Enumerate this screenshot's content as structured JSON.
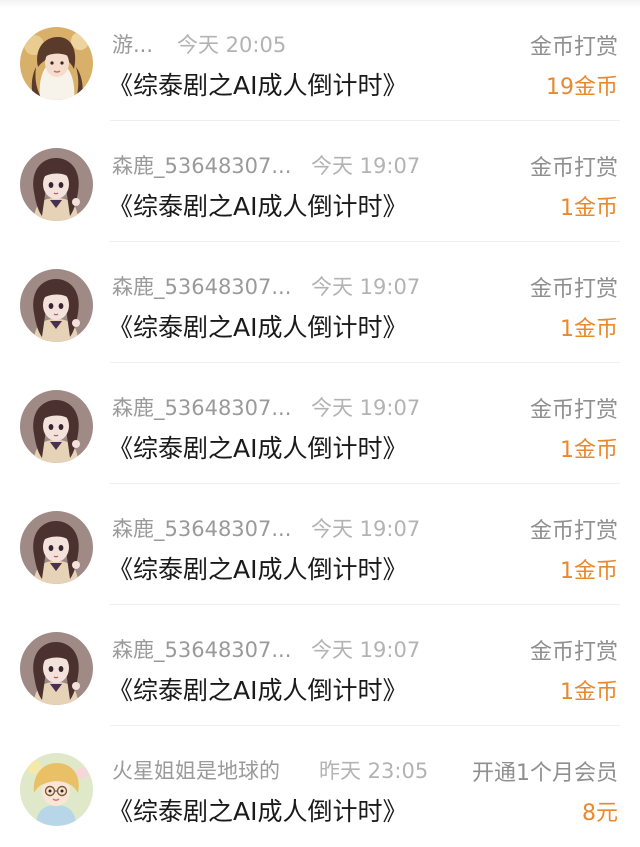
{
  "colors": {
    "amount": "#e8892e",
    "name": "#9a9a9a",
    "time": "#b3b3b3",
    "type": "#8f8f8f",
    "title": "#1a1a1a"
  },
  "records": [
    {
      "avatar_icon": "girl-golden-hair-avatar-icon",
      "user": "游...",
      "time": "今天 20:05",
      "type": "金币打赏",
      "book": "《综泰剧之AI成人倒计时》",
      "amount": "19金币"
    },
    {
      "avatar_icon": "anime-girl-avatar-icon",
      "user": "森鹿_53648307...",
      "time": "今天 19:07",
      "type": "金币打赏",
      "book": "《综泰剧之AI成人倒计时》",
      "amount": "1金币"
    },
    {
      "avatar_icon": "anime-girl-avatar-icon",
      "user": "森鹿_53648307...",
      "time": "今天 19:07",
      "type": "金币打赏",
      "book": "《综泰剧之AI成人倒计时》",
      "amount": "1金币"
    },
    {
      "avatar_icon": "anime-girl-avatar-icon",
      "user": "森鹿_53648307...",
      "time": "今天 19:07",
      "type": "金币打赏",
      "book": "《综泰剧之AI成人倒计时》",
      "amount": "1金币"
    },
    {
      "avatar_icon": "anime-girl-avatar-icon",
      "user": "森鹿_53648307...",
      "time": "今天 19:07",
      "type": "金币打赏",
      "book": "《综泰剧之AI成人倒计时》",
      "amount": "1金币"
    },
    {
      "avatar_icon": "anime-girl-avatar-icon",
      "user": "森鹿_53648307...",
      "time": "今天 19:07",
      "type": "金币打赏",
      "book": "《综泰剧之AI成人倒计时》",
      "amount": "1金币"
    },
    {
      "avatar_icon": "cartoon-girl-glasses-avatar-icon",
      "user": "火星姐姐是地球的",
      "time": "昨天 23:05",
      "type": "开通1个月会员",
      "book": "《综泰剧之AI成人倒计时》",
      "amount": "8元"
    }
  ]
}
